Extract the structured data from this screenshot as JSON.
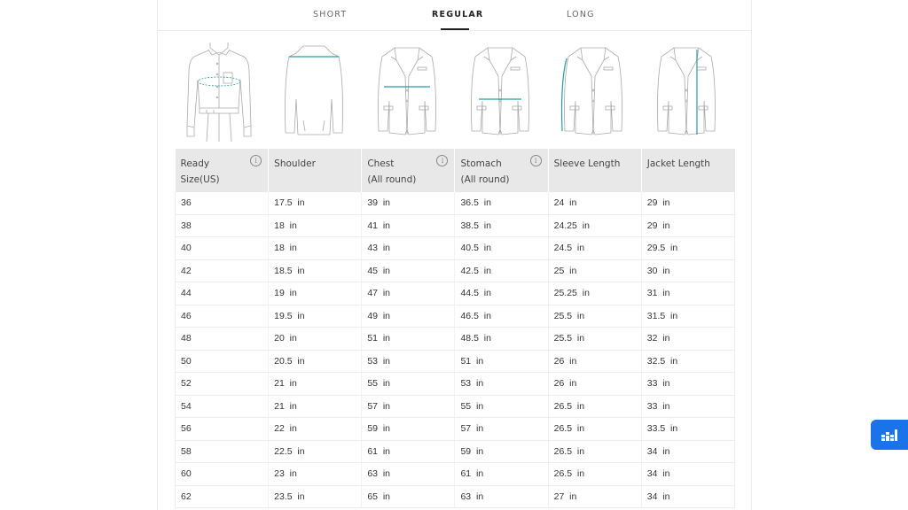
{
  "tabs": [
    {
      "label": "SHORT",
      "active": false
    },
    {
      "label": "REGULAR",
      "active": true
    },
    {
      "label": "LONG",
      "active": false
    }
  ],
  "figures": [
    {
      "name": "shirt-chest-figure",
      "measure": "Ready Size"
    },
    {
      "name": "shoulder-figure",
      "measure": "Shoulder"
    },
    {
      "name": "chest-figure",
      "measure": "Chest"
    },
    {
      "name": "stomach-figure",
      "measure": "Stomach"
    },
    {
      "name": "sleeve-length-figure",
      "measure": "Sleeve Length"
    },
    {
      "name": "jacket-length-figure",
      "measure": "Jacket Length"
    }
  ],
  "accent_color": "#2b9aa3",
  "table": {
    "headers": [
      {
        "line1": "Ready",
        "line2": "Size(US)",
        "info": true
      },
      {
        "line1": "Shoulder",
        "line2": "",
        "info": false
      },
      {
        "line1": "Chest",
        "line2": "(All round)",
        "info": true
      },
      {
        "line1": "Stomach",
        "line2": "(All round)",
        "info": true
      },
      {
        "line1": "Sleeve Length",
        "line2": "",
        "info": false
      },
      {
        "line1": "Jacket Length",
        "line2": "",
        "info": false
      }
    ],
    "rows": [
      [
        "36",
        "17.5  in",
        "39  in",
        "36.5  in",
        "24  in",
        "29  in"
      ],
      [
        "38",
        "18  in",
        "41  in",
        "38.5  in",
        "24.25  in",
        "29  in"
      ],
      [
        "40",
        "18  in",
        "43  in",
        "40.5  in",
        "24.5  in",
        "29.5  in"
      ],
      [
        "42",
        "18.5  in",
        "45  in",
        "42.5  in",
        "25  in",
        "30  in"
      ],
      [
        "44",
        "19  in",
        "47  in",
        "44.5  in",
        "25.25  in",
        "31  in"
      ],
      [
        "46",
        "19.5  in",
        "49  in",
        "46.5  in",
        "25.5  in",
        "31.5  in"
      ],
      [
        "48",
        "20  in",
        "51  in",
        "48.5  in",
        "25.5  in",
        "32  in"
      ],
      [
        "50",
        "20.5  in",
        "53  in",
        "51  in",
        "26  in",
        "32.5  in"
      ],
      [
        "52",
        "21  in",
        "55  in",
        "53  in",
        "26  in",
        "33  in"
      ],
      [
        "54",
        "21  in",
        "57  in",
        "55  in",
        "26.5  in",
        "33  in"
      ],
      [
        "56",
        "22  in",
        "59  in",
        "57  in",
        "26.5  in",
        "33.5  in"
      ],
      [
        "58",
        "22.5  in",
        "61  in",
        "59  in",
        "26.5  in",
        "34  in"
      ],
      [
        "60",
        "23  in",
        "63  in",
        "61  in",
        "26.5  in",
        "34  in"
      ],
      [
        "62",
        "23.5  in",
        "65  in",
        "63  in",
        "27  in",
        "34  in"
      ]
    ]
  },
  "float_button": {
    "icon": "chart-widget-icon",
    "color": "#1a73e8"
  }
}
